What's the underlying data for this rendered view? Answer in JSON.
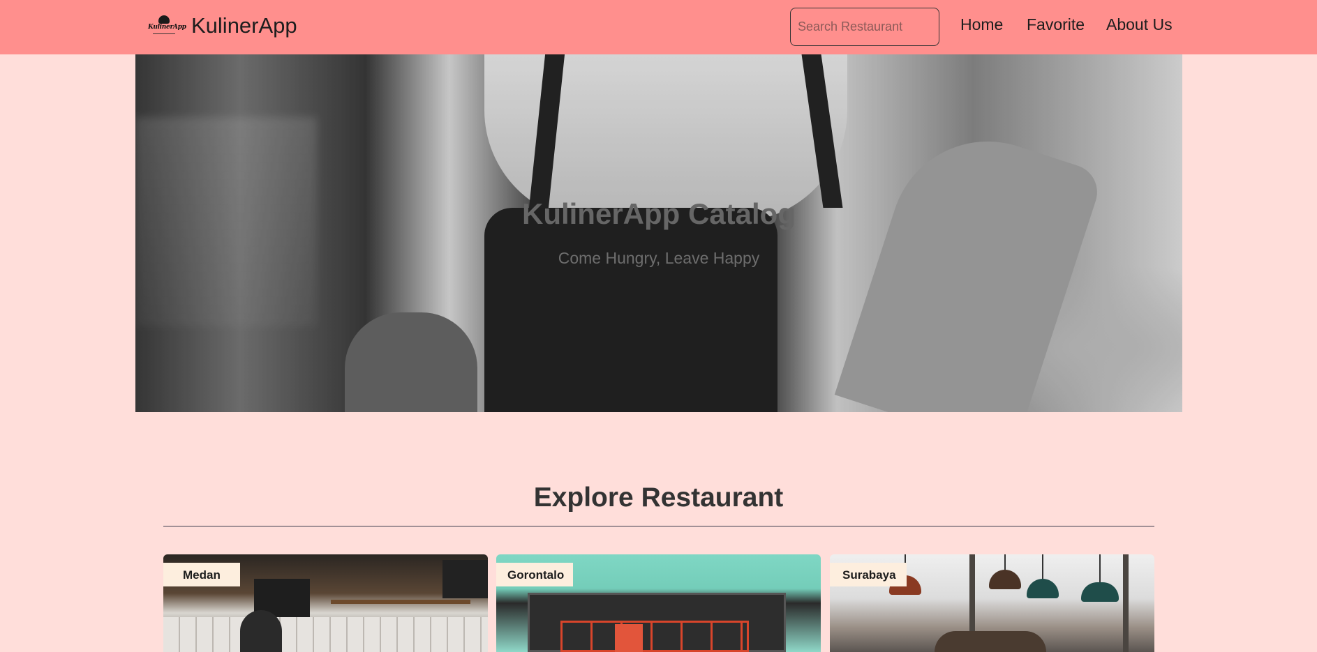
{
  "header": {
    "logo_text": "KulinerApp",
    "brand_name": "KulinerApp",
    "search_placeholder": "Search Restaurant",
    "search_value": "",
    "nav": [
      {
        "label": "Home"
      },
      {
        "label": "Favorite"
      },
      {
        "label": "About Us"
      }
    ]
  },
  "hero": {
    "title": "KulinerApp Catalog",
    "subtitle": "Come Hungry, Leave Happy"
  },
  "explore": {
    "title": "Explore Restaurant",
    "cards": [
      {
        "city": "Medan"
      },
      {
        "city": "Gorontalo"
      },
      {
        "city": "Surabaya"
      }
    ]
  },
  "colors": {
    "header_bg": "#ff8f8d",
    "page_bg": "#ffdeda",
    "badge_bg": "#fdeede"
  },
  "icons": {
    "logo": "chef-hat-logo-icon"
  }
}
